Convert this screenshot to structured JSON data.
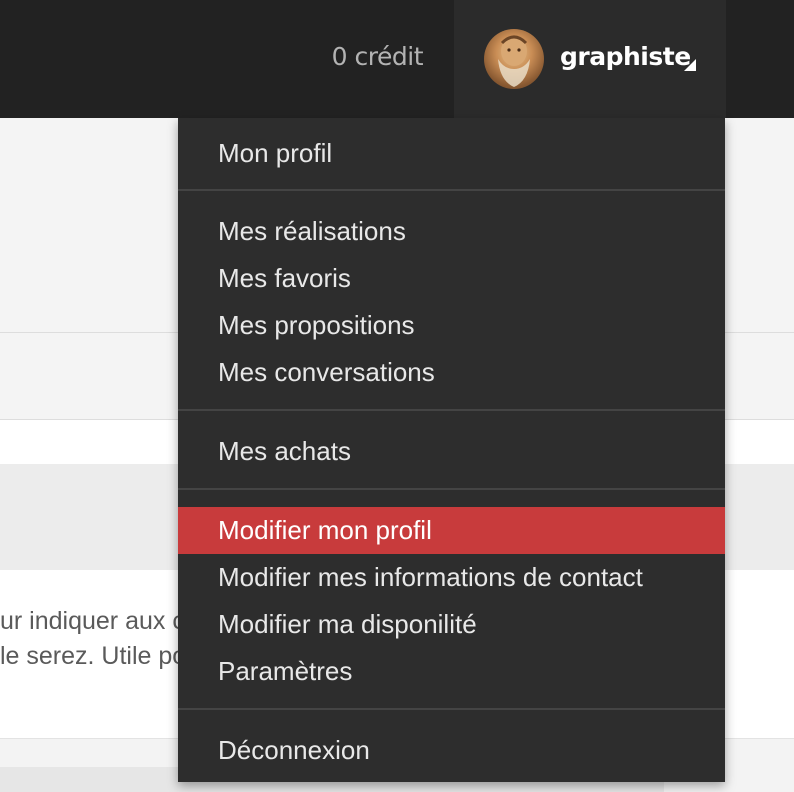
{
  "navbar": {
    "credit_label": "0 crédit",
    "username": "graphiste",
    "avatar_icon": "portrait-avatar-icon",
    "caret_icon": "caret-up-icon"
  },
  "page": {
    "body_text_line1": "ur indiquer aux clients qui visitent votre profil si vous",
    "body_text_line2": "le serez. Utile pour vendre votre temps entre deux"
  },
  "dropdown": {
    "items": [
      {
        "label": "Mon profil"
      },
      {
        "label": "Mes réalisations"
      },
      {
        "label": "Mes favoris"
      },
      {
        "label": "Mes propositions"
      },
      {
        "label": "Mes conversations"
      },
      {
        "label": "Mes achats"
      },
      {
        "label": "Modifier mon profil",
        "active": true
      },
      {
        "label": "Modifier mes informations de contact"
      },
      {
        "label": "Modifier ma disponilité"
      },
      {
        "label": "Paramètres"
      },
      {
        "label": "Déconnexion"
      }
    ],
    "active_color": "#c83b3c"
  }
}
